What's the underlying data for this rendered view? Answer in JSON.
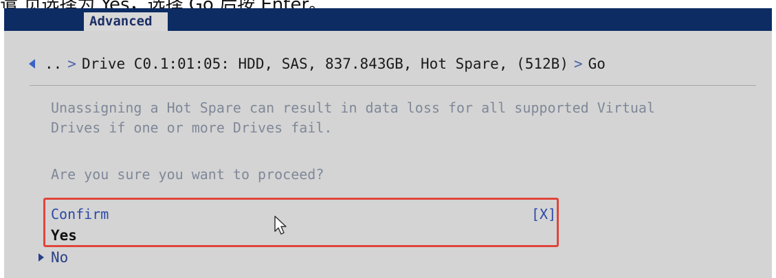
{
  "caption_fragment": "遣 页选择为 Yes，选择 Go 后按 Enter。",
  "header": {
    "tab_label": "Advanced"
  },
  "breadcrumb": {
    "parent": "..",
    "separator": ">",
    "current": "Drive C0.1:01:05: HDD, SAS, 837.843GB, Hot Spare, (512B)",
    "action": "Go"
  },
  "message": {
    "line1": "Unassigning a Hot Spare can result in data loss for all supported Virtual",
    "line2": "Drives if one or more Drives fail.",
    "question": "Are you sure you want to proceed?"
  },
  "confirm": {
    "label": "Confirm",
    "state": "[X]"
  },
  "options": [
    {
      "label": "Yes"
    },
    {
      "label": "No"
    }
  ],
  "colors": {
    "header_bar": "#0c2c63",
    "panel": "#d4d4d4",
    "highlight_border": "#e0443c",
    "link_blue": "#2a48a8"
  }
}
